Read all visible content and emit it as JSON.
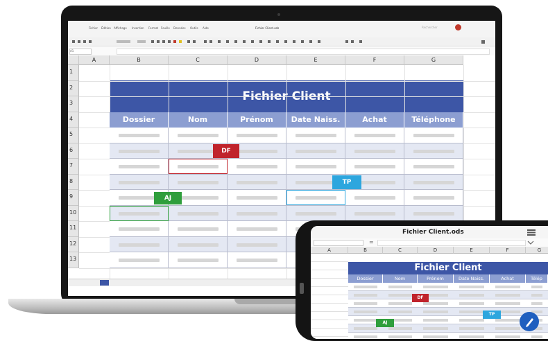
{
  "laptop": {
    "menu": [
      "Fichier",
      "Édition",
      "Affichage",
      "Insertion",
      "Format",
      "Feuille",
      "Données",
      "Outils",
      "Aide"
    ],
    "doc_title": "Fichier Client.ods",
    "search_placeholder": "Rechercher",
    "namebox": "A1",
    "columns": [
      "A",
      "B",
      "C",
      "D",
      "E",
      "F",
      "G"
    ],
    "rows": [
      "1",
      "2",
      "3",
      "4",
      "5",
      "6",
      "7",
      "8",
      "9",
      "10",
      "11",
      "12",
      "13"
    ],
    "sheet_title": "Fichier Client",
    "headers": [
      "Dossier",
      "Nom",
      "Prénom",
      "Date Naiss.",
      "Achat",
      "Téléphone"
    ],
    "cursors": [
      {
        "label": "DF",
        "color": "#c0232b"
      },
      {
        "label": "TP",
        "color": "#2da6de"
      },
      {
        "label": "AJ",
        "color": "#2f9e3c"
      }
    ]
  },
  "phone": {
    "file_name": "Fichier Client.ods",
    "formula_eq": "=",
    "columns": [
      "A",
      "B",
      "C",
      "D",
      "E",
      "F",
      "G"
    ],
    "sheet_title": "Fichier Client",
    "headers": [
      "Dossier",
      "Nom",
      "Prénom",
      "Date Naiss.",
      "Achat",
      "Télép"
    ],
    "cursors": [
      {
        "label": "DF",
        "color": "#c0232b"
      },
      {
        "label": "TP",
        "color": "#2da6de"
      },
      {
        "label": "AJ",
        "color": "#2f9e3c"
      }
    ],
    "fab_icon": "edit-pencil-icon"
  },
  "colors": {
    "title_band": "#3d56a6",
    "header_band": "#8c9ed1",
    "fab": "#1f5fbf"
  }
}
